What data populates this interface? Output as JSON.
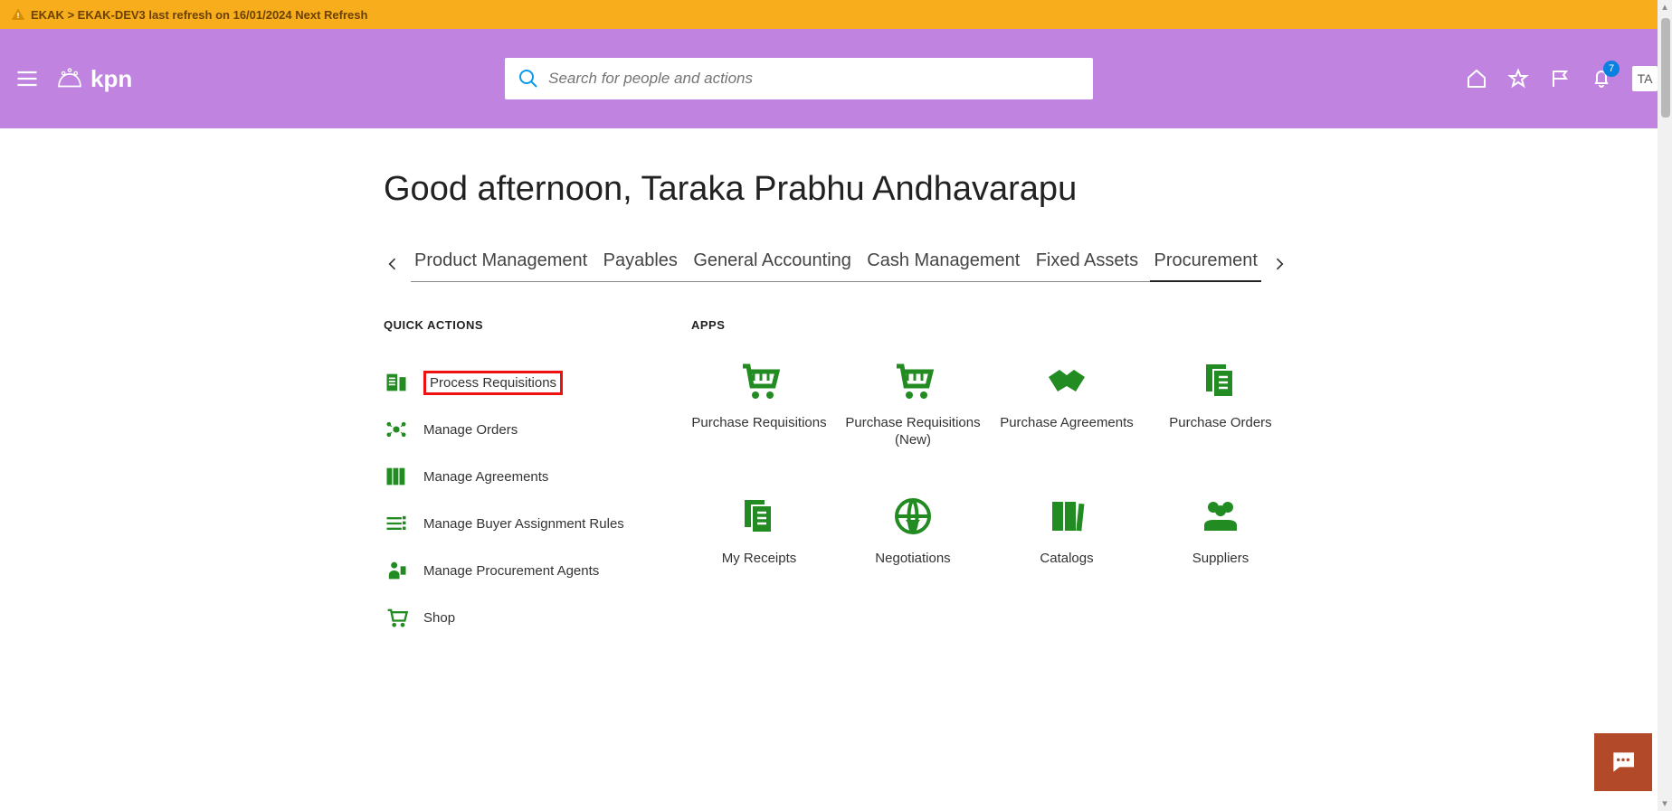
{
  "banner": {
    "text": "EKAK > EKAK-DEV3 last refresh on 16/01/2024 Next Refresh"
  },
  "colors": {
    "banner_bg": "#f8ae1c",
    "header_bg": "#c183e0",
    "accent_green": "#228b22",
    "chat_bg": "#b24a2a",
    "notif_bg": "#0a81e0",
    "highlight_border": "#e11"
  },
  "header": {
    "brand": "kpn",
    "search_placeholder": "Search for people and actions",
    "notifications_count": "7",
    "user_initials": "TA"
  },
  "greeting": "Good afternoon, Taraka Prabhu Andhavarapu",
  "tabs": {
    "items": [
      {
        "label": "Product Management",
        "active": false
      },
      {
        "label": "Payables",
        "active": false
      },
      {
        "label": "General Accounting",
        "active": false
      },
      {
        "label": "Cash Management",
        "active": false
      },
      {
        "label": "Fixed Assets",
        "active": false
      },
      {
        "label": "Procurement",
        "active": true
      }
    ]
  },
  "sections": {
    "quick_title": "QUICK ACTIONS",
    "apps_title": "APPS"
  },
  "quick_actions": [
    {
      "label": "Process Requisitions",
      "icon": "requisitions-icon",
      "highlight": true
    },
    {
      "label": "Manage Orders",
      "icon": "orders-icon"
    },
    {
      "label": "Manage Agreements",
      "icon": "agreements-icon"
    },
    {
      "label": "Manage Buyer Assignment Rules",
      "icon": "rules-icon"
    },
    {
      "label": "Manage Procurement Agents",
      "icon": "agents-icon"
    },
    {
      "label": "Shop",
      "icon": "shop-icon"
    }
  ],
  "apps": [
    {
      "label": "Purchase Requisitions",
      "icon": "cart-icon"
    },
    {
      "label": "Purchase Requisitions (New)",
      "icon": "cart-icon"
    },
    {
      "label": "Purchase Agreements",
      "icon": "handshake-icon"
    },
    {
      "label": "Purchase Orders",
      "icon": "documents-icon"
    },
    {
      "label": "My Receipts",
      "icon": "documents-icon"
    },
    {
      "label": "Negotiations",
      "icon": "globe-icon"
    },
    {
      "label": "Catalogs",
      "icon": "books-icon"
    },
    {
      "label": "Suppliers",
      "icon": "people-icon"
    }
  ]
}
